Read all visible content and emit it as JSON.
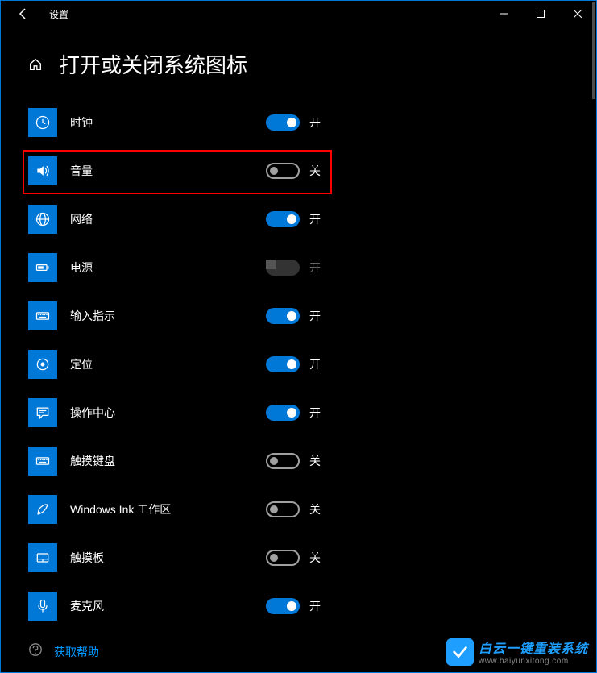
{
  "window": {
    "title": "设置",
    "controls": {
      "minimize": "minimize",
      "maximize": "maximize",
      "close": "close"
    }
  },
  "header": {
    "title": "打开或关闭系统图标"
  },
  "toggleLabels": {
    "on": "开",
    "off": "关"
  },
  "items": [
    {
      "id": "clock",
      "icon": "clock-icon",
      "label": "时钟",
      "state": "on",
      "enabled": true
    },
    {
      "id": "volume",
      "icon": "volume-icon",
      "label": "音量",
      "state": "off",
      "enabled": true,
      "highlighted": true
    },
    {
      "id": "network",
      "icon": "network-icon",
      "label": "网络",
      "state": "on",
      "enabled": true
    },
    {
      "id": "power",
      "icon": "power-icon",
      "label": "电源",
      "state": "on",
      "enabled": false
    },
    {
      "id": "input",
      "icon": "keyboard-icon",
      "label": "输入指示",
      "state": "on",
      "enabled": true
    },
    {
      "id": "location",
      "icon": "location-icon",
      "label": "定位",
      "state": "on",
      "enabled": true
    },
    {
      "id": "action-center",
      "icon": "action-center-icon",
      "label": "操作中心",
      "state": "on",
      "enabled": true
    },
    {
      "id": "touch-keyboard",
      "icon": "touch-keyboard-icon",
      "label": "触摸键盘",
      "state": "off",
      "enabled": true
    },
    {
      "id": "windows-ink",
      "icon": "pen-icon",
      "label": "Windows Ink 工作区",
      "state": "off",
      "enabled": true
    },
    {
      "id": "touchpad",
      "icon": "touchpad-icon",
      "label": "触摸板",
      "state": "off",
      "enabled": true
    },
    {
      "id": "microphone",
      "icon": "microphone-icon",
      "label": "麦克风",
      "state": "on",
      "enabled": true
    }
  ],
  "footer": {
    "helpText": "获取帮助"
  },
  "watermark": {
    "line1": "白云一键重装系统",
    "line2": "www.baiyunxitong.com"
  }
}
